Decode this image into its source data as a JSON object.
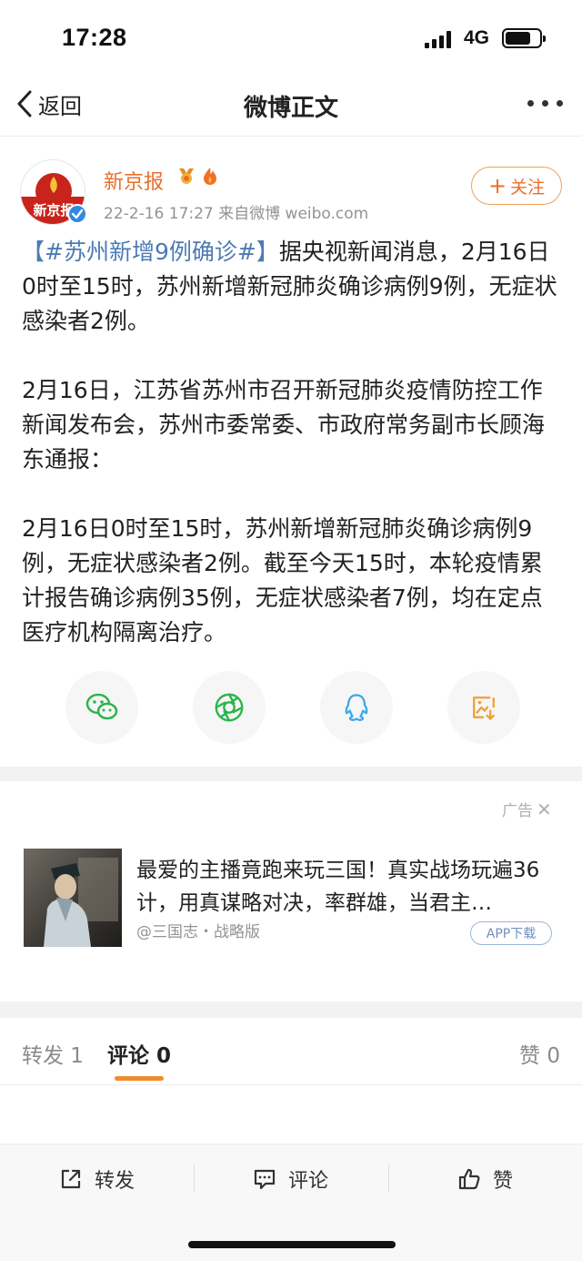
{
  "status_bar": {
    "time": "17:28",
    "network": "4G",
    "battery_level": 0.75
  },
  "nav": {
    "back_label": "返回",
    "title": "微博正文"
  },
  "post": {
    "author": "新京报",
    "avatar_text": "新京报",
    "meta": "22-2-16 17:27  来自微博 weibo.com",
    "follow_label": "关注",
    "paragraphs": [
      {
        "hashtag": "【#苏州新增9例确诊#】",
        "text": "据央视新闻消息，2月16日0时至15时，苏州新增新冠肺炎确诊病例9例，无症状感染者2例。"
      },
      {
        "hashtag": "",
        "text": "2月16日，江苏省苏州市召开新冠肺炎疫情防控工作新闻发布会，苏州市委常委、市政府常务副市长顾海东通报："
      },
      {
        "hashtag": "",
        "text": "2月16日0时至15时，苏州新增新冠肺炎确诊病例9例，无症状感染者2例。截至今天15时，本轮疫情累计报告确诊病例35例，无症状感染者7例，均在定点医疗机构隔离治疗。"
      }
    ]
  },
  "share": {
    "icons": [
      "wechat-icon",
      "moments-icon",
      "qq-icon",
      "save-image-icon"
    ]
  },
  "ad": {
    "tag": "广告",
    "text": "最爱的主播竟跑来玩三国！真实战场玩遍36计，用真谋略对决，率群雄，当君主…",
    "source": "@三国志・战略版",
    "button": "APP下载"
  },
  "tabs": {
    "repost": "转发 1",
    "comment": "评论 0",
    "like": "赞 0"
  },
  "toolbar": {
    "repost": "转发",
    "comment": "评论",
    "like": "赞"
  },
  "colors": {
    "accent": "#e8702a",
    "link": "#4d7bb3",
    "tab_underline": "#f08c30"
  }
}
